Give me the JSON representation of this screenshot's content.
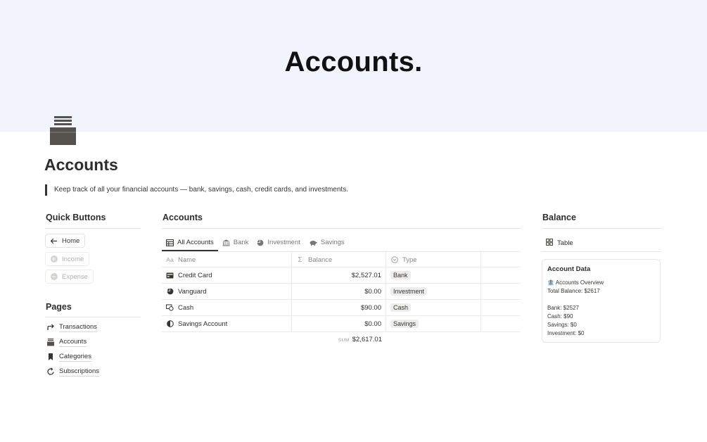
{
  "cover": {
    "title": "Accounts."
  },
  "page": {
    "title": "Accounts",
    "quote": "Keep track of all your financial accounts — bank, savings, cash, credit cards, and investments."
  },
  "quick_buttons": {
    "heading": "Quick Buttons",
    "items": [
      {
        "label": "Home",
        "icon": "arrow-left-icon",
        "enabled": true
      },
      {
        "label": "Income",
        "icon": "plus-circle-icon",
        "enabled": false
      },
      {
        "label": "Expense",
        "icon": "minus-circle-icon",
        "enabled": false
      }
    ]
  },
  "pages": {
    "heading": "Pages",
    "items": [
      {
        "label": "Transactions",
        "icon": "redo-arrow-icon"
      },
      {
        "label": "Accounts",
        "icon": "archive-box-icon"
      },
      {
        "label": "Categories",
        "icon": "bookmark-icon"
      },
      {
        "label": "Subscriptions",
        "icon": "refresh-icon"
      }
    ]
  },
  "accounts": {
    "heading": "Accounts",
    "tabs": [
      {
        "label": "All Accounts",
        "icon": "table-icon",
        "active": true
      },
      {
        "label": "Bank",
        "icon": "bank-icon",
        "active": false
      },
      {
        "label": "Investment",
        "icon": "pie-chart-icon",
        "active": false
      },
      {
        "label": "Savings",
        "icon": "piggy-bank-icon",
        "active": false
      }
    ],
    "columns": [
      {
        "label": "Name",
        "icon": "text-type-icon"
      },
      {
        "label": "Balance",
        "icon": "sigma-icon"
      },
      {
        "label": "Type",
        "icon": "select-circle-icon"
      }
    ],
    "rows": [
      {
        "name": "Credit Card",
        "icon": "credit-card-icon",
        "balance": "$2,527.01",
        "type": "Bank"
      },
      {
        "name": "Vanguard",
        "icon": "pie-chart-icon",
        "balance": "$0.00",
        "type": "Investment"
      },
      {
        "name": "Cash",
        "icon": "cash-icon",
        "balance": "$90.00",
        "type": "Cash"
      },
      {
        "name": "Savings Account",
        "icon": "half-circle-icon",
        "balance": "$0.00",
        "type": "Savings"
      }
    ],
    "sum_label": "SUM",
    "sum_value": "$2,617.01"
  },
  "balance": {
    "heading": "Balance",
    "view_tab": "Table",
    "card": {
      "title": "Account Data",
      "lines": [
        "🏦 Accounts Overview",
        "Total Balance: $2617",
        "",
        "Bank: $2527",
        "Cash: $90",
        "Savings: $0",
        "Investment: $0"
      ]
    }
  }
}
